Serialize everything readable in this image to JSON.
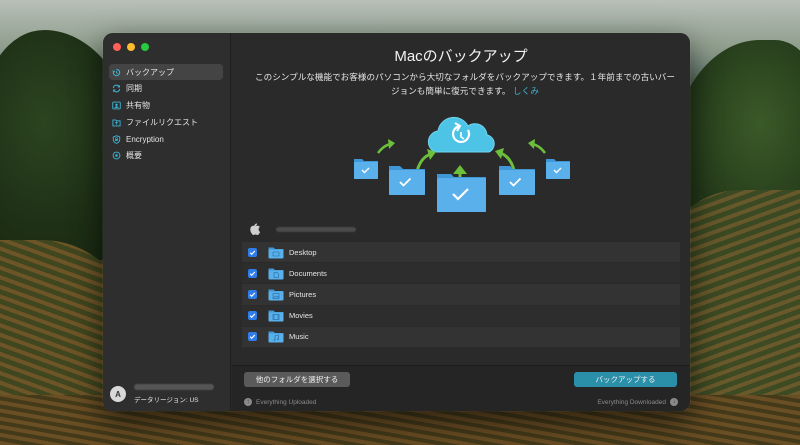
{
  "sidebar": {
    "items": [
      {
        "label": "バックアップ",
        "icon": "backup-icon",
        "active": true
      },
      {
        "label": "同期",
        "icon": "sync-icon",
        "active": false
      },
      {
        "label": "共有物",
        "icon": "shared-icon",
        "active": false
      },
      {
        "label": "ファイルリクエスト",
        "icon": "file-request-icon",
        "active": false
      },
      {
        "label": "Encryption",
        "icon": "encryption-icon",
        "active": false
      },
      {
        "label": "概要",
        "icon": "overview-icon",
        "active": false
      }
    ],
    "account": {
      "avatar_letter": "A",
      "region": "データリージョン: US"
    }
  },
  "main": {
    "title": "Macのバックアップ",
    "description": "このシンプルな機能でお客様のパソコンから大切なフォルダをバックアップできます。１年前までの古いバージョンも簡単に復元できます。",
    "learn_more": "しくみ",
    "folders": [
      {
        "name": "Desktop",
        "checked": true
      },
      {
        "name": "Documents",
        "checked": true
      },
      {
        "name": "Pictures",
        "checked": true
      },
      {
        "name": "Movies",
        "checked": true
      },
      {
        "name": "Music",
        "checked": true
      }
    ],
    "buttons": {
      "select_other": "他のフォルダを選択する",
      "backup": "バックアップする"
    },
    "status": {
      "uploaded": "Everything Uploaded",
      "downloaded": "Everything Downloaded"
    }
  },
  "colors": {
    "accent": "#3ab6d6",
    "backup_button": "#2a8fa8",
    "checkbox": "#2f7dea",
    "arrow_green": "#6cbf3a"
  }
}
